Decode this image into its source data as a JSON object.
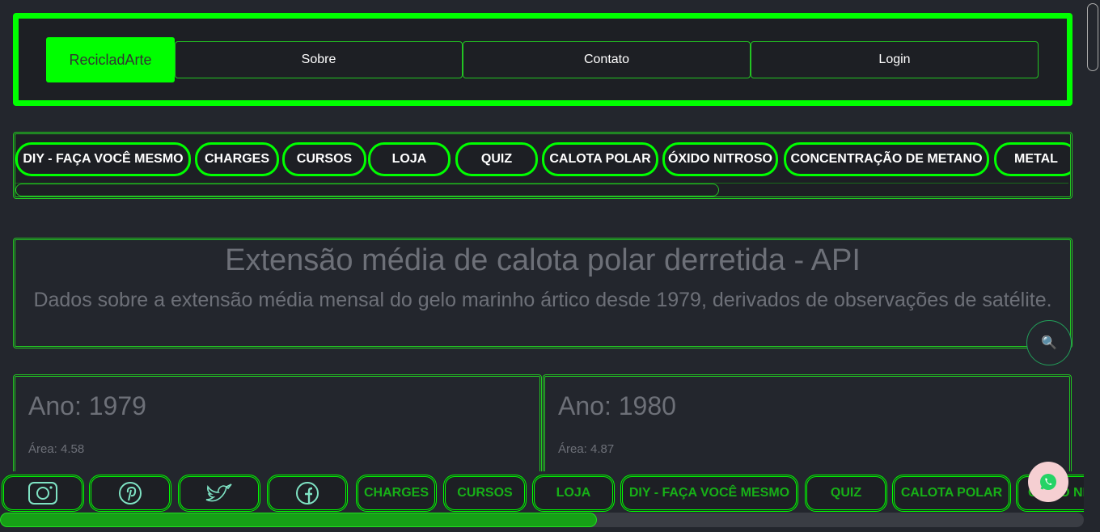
{
  "header": {
    "brand": "RecicladArte",
    "nav": [
      "Sobre",
      "Contato",
      "Login"
    ]
  },
  "categories": [
    "DIY - FAÇA VOCÊ MESMO",
    "CHARGES",
    "CURSOS",
    "LOJA",
    "QUIZ",
    "CALOTA POLAR",
    "ÓXIDO NITROSO",
    "CONCENTRAÇÃO DE METANO",
    "METAL"
  ],
  "main": {
    "title": "Extensão média de calota polar derretida - API",
    "subtitle": "Dados sobre a extensão média mensal do gelo marinho ártico desde 1979, derivados de observações de satélite.",
    "cards": [
      {
        "ano": "Ano: 1979",
        "area": "Área: 4.58"
      },
      {
        "ano": "Ano: 1980",
        "area": "Área: 4.87"
      }
    ]
  },
  "bottom_bar": {
    "social": [
      "instagram-icon",
      "pinterest-icon",
      "twitter-icon",
      "facebook-icon"
    ],
    "links": [
      "CHARGES",
      "CURSOS",
      "LOJA",
      "DIY - FAÇA VOCÊ MESMO",
      "QUIZ",
      "CALOTA POLAR",
      "ÓXIDO NI"
    ]
  },
  "colors": {
    "accent": "#00ff00",
    "background": "#23262d",
    "text_muted": "#6d7078",
    "whatsapp_bg": "#f5cfd2",
    "whatsapp": "#25d366"
  }
}
